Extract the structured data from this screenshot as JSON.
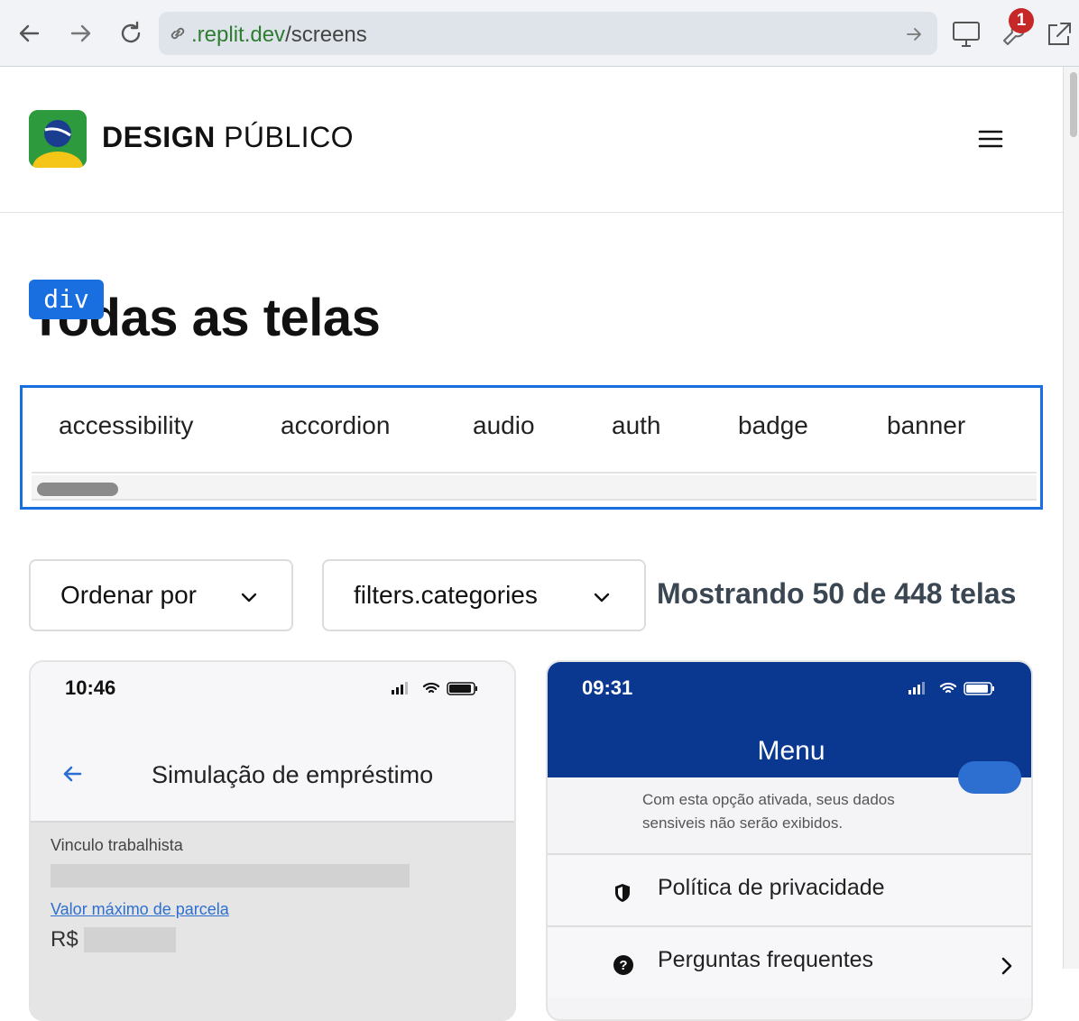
{
  "browser": {
    "url_domain": ".replit.dev",
    "url_path": "/screens",
    "notification_count": "1"
  },
  "header": {
    "brand_bold": "DESIGN",
    "brand_regular": "PÚBLICO"
  },
  "main": {
    "title": "Todas as telas",
    "inspector_tag": "div",
    "tags": [
      "accessibility",
      "accordion",
      "audio",
      "auth",
      "badge",
      "banner"
    ],
    "sort_label": "Ordenar por",
    "category_label": "filters.categories",
    "count_text": "Mostrando 50 de 448 telas"
  },
  "cards": [
    {
      "time": "10:46",
      "title": "Simulação de empréstimo",
      "field_label": "Vinculo trabalhista",
      "link": "Valor máximo de parcela",
      "currency": "R$"
    },
    {
      "time": "09:31",
      "title": "Menu",
      "note_line1": "Com esta opção ativada, seus dados",
      "note_line2": "sensiveis não serão exibidos.",
      "row1": "Política de privacidade",
      "row2": "Perguntas frequentes"
    }
  ],
  "colors": {
    "accent": "#1a6fe0",
    "header_blue": "#0a3891",
    "brand_green": "#2e9a3e"
  }
}
